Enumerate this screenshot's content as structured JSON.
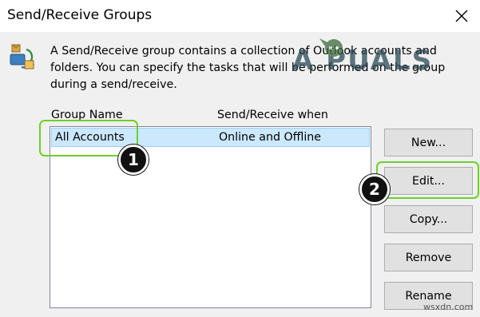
{
  "window": {
    "title": "Send/Receive Groups",
    "close_icon": "close-icon"
  },
  "description": "A Send/Receive group contains a collection of Outlook accounts and folders. You can specify the tasks that will be performed on the group during a send/receive.",
  "table": {
    "columns": [
      "Group Name",
      "Send/Receive when"
    ],
    "rows": [
      {
        "group_name": "All Accounts",
        "when": "Online and Offline",
        "selected": true
      }
    ]
  },
  "buttons": {
    "new": "New...",
    "edit": "Edit...",
    "copy": "Copy...",
    "remove": "Remove",
    "rename": "Rename"
  },
  "annotations": {
    "badge_1": "1",
    "badge_2": "2",
    "highlight_color": "#6cd12a"
  },
  "watermark": "A PUALS",
  "site_mark": "wsxdn.com",
  "colors": {
    "selection": "#cce8ff",
    "selection_border": "#99d1ff",
    "button_bg": "#e1e1e1"
  }
}
